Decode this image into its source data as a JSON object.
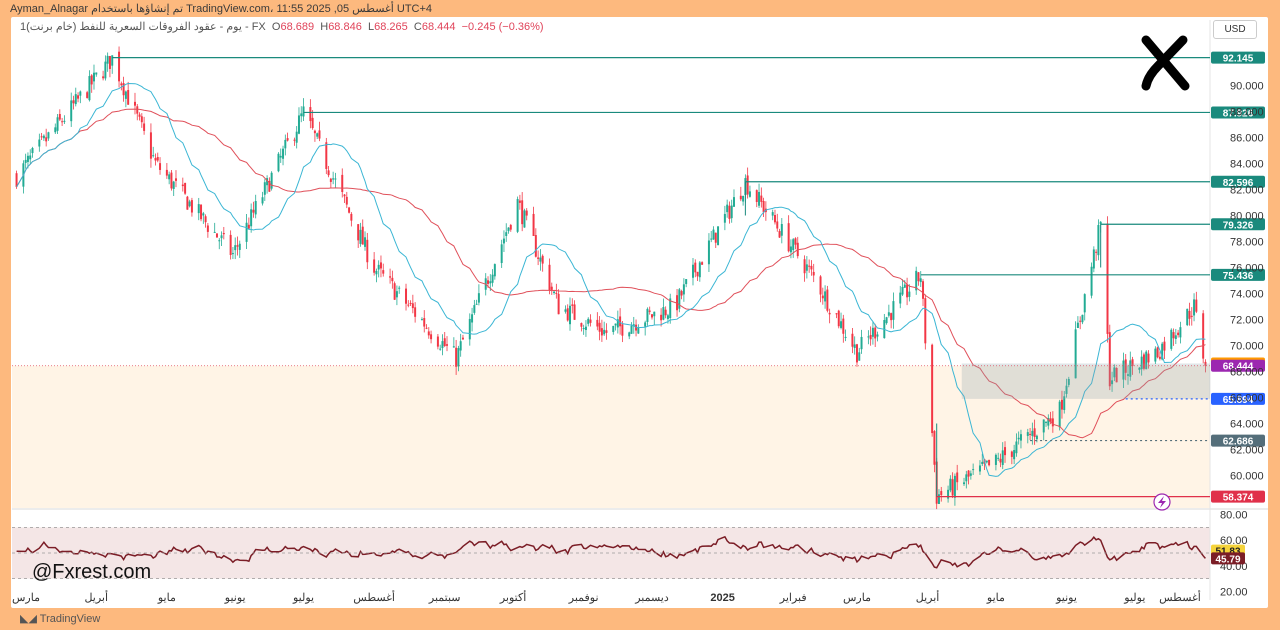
{
  "header": {
    "attribution": "Ayman_Alnagar تم إنشاؤها باستخدام TradingView.com، 11:55 2025 ,05 أغسطس UTC+4"
  },
  "legend": {
    "symbol": "1يوم - عقود الفروقات السعرية للنفط (خام برنت) - FX",
    "open_label": "O",
    "open": "68.689",
    "high_label": "H",
    "high": "68.846",
    "low_label": "L",
    "low": "68.265",
    "close_label": "C",
    "close": "68.444",
    "change": "−0.245 (−0.36%)"
  },
  "currency": "USD",
  "footer": {
    "brand": "TradingView"
  },
  "watermark": "@Fxrest.com",
  "colors": {
    "up": "#22ab94",
    "down": "#f23645",
    "ma_fast": "#3bb6d4",
    "ma_slow": "#e0505a",
    "level": "#1a8a7d",
    "rsi": "#7b1d26",
    "last_price": "#9c27b0",
    "prev_close": "#ff9800",
    "support_1": "#2962ff",
    "support_2": "#546e7a",
    "low_level": "#e0304a"
  },
  "chart_data": [
    {
      "type": "candlestick",
      "title": "",
      "ylabel": "",
      "ylim": [
        57.5,
        93.5
      ],
      "y_ticks": [
        60,
        62,
        64,
        66,
        68,
        70,
        72,
        74,
        76,
        78,
        80,
        82,
        84,
        86,
        88,
        90
      ],
      "y_tick_labels": [
        "60.000",
        "62.000",
        "64.000",
        "66.000",
        "68.000",
        "70.000",
        "72.000",
        "74.000",
        "76.000",
        "78.000",
        "80.000",
        "82.000",
        "84.000",
        "86.000",
        "88.000",
        "90.000"
      ],
      "x_labels": [
        "مارس",
        "أبريل",
        "مايو",
        "يونيو",
        "يوليو",
        "أغسطس",
        "سبتمبر",
        "أكتوبر",
        "نوفمبر",
        "ديسمبر",
        "2025",
        "فبراير",
        "مارس",
        "أبريل",
        "مايو",
        "يونيو",
        "يوليو",
        "أغسطس"
      ],
      "last_price": 68.444,
      "price_series_approx": {
        "dates": [
          "2024-03-01",
          "2024-04-12",
          "2024-05-01",
          "2024-06-04",
          "2024-07-05",
          "2024-08-05",
          "2024-09-10",
          "2024-10-07",
          "2024-10-25",
          "2024-11-15",
          "2024-12-15",
          "2025-01-15",
          "2025-02-15",
          "2025-03-05",
          "2025-04-02",
          "2025-04-09",
          "2025-05-05",
          "2025-06-02",
          "2025-06-20",
          "2025-06-24",
          "2025-07-15",
          "2025-07-31",
          "2025-08-05"
        ],
        "close": [
          83.0,
          92.1,
          84.0,
          77.0,
          87.9,
          76.0,
          69.0,
          81.0,
          73.0,
          71.0,
          73.0,
          82.6,
          75.0,
          69.5,
          75.4,
          58.4,
          61.0,
          65.0,
          79.3,
          67.5,
          69.5,
          73.0,
          68.4
        ]
      },
      "levels": [
        {
          "label": "92.145",
          "value": 92.145,
          "style": "solid"
        },
        {
          "label": "87.926",
          "value": 87.926,
          "style": "solid"
        },
        {
          "label": "82.596",
          "value": 82.596,
          "style": "solid"
        },
        {
          "label": "79.326",
          "value": 79.326,
          "style": "solid"
        },
        {
          "label": "75.436",
          "value": 75.436,
          "style": "solid"
        },
        {
          "label": "68.616",
          "value": 68.616,
          "style": "badge"
        },
        {
          "label": "68.444",
          "value": 68.444,
          "style": "last"
        },
        {
          "label": "65.894",
          "value": 65.894,
          "style": "dotted"
        },
        {
          "label": "62.686",
          "value": 62.686,
          "style": "dotted"
        },
        {
          "label": "58.374",
          "value": 58.374,
          "style": "solid"
        }
      ],
      "zone": {
        "from": 65.894,
        "to": 68.616
      }
    },
    {
      "type": "line",
      "title": "",
      "ylim": [
        18,
        82
      ],
      "y_ticks": [
        20,
        40,
        60,
        80
      ],
      "y_tick_labels": [
        "20.00",
        "40.00",
        "60.00",
        "80.00"
      ],
      "band": [
        30,
        70
      ],
      "badges": [
        {
          "label": "51.83",
          "value": 51.83
        },
        {
          "label": "45.79",
          "value": 45.79
        }
      ]
    }
  ]
}
